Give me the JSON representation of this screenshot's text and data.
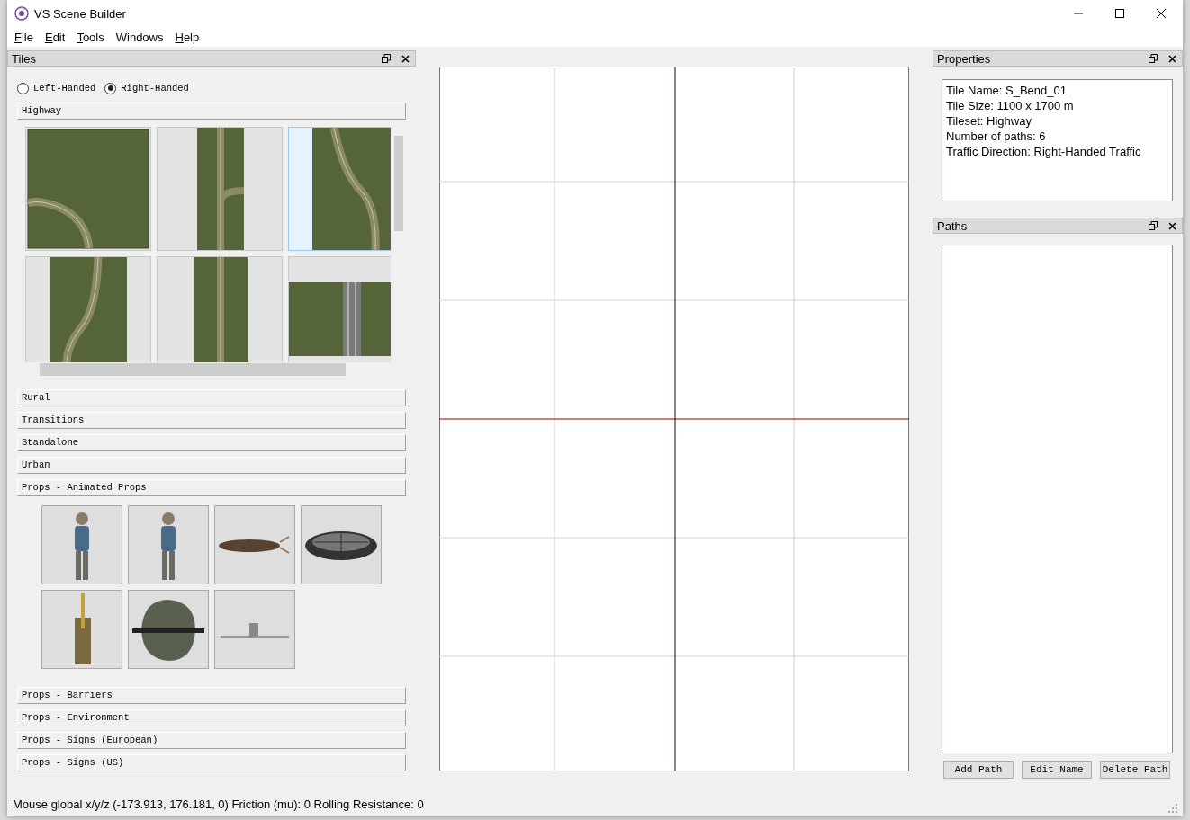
{
  "window": {
    "title": "VS Scene Builder"
  },
  "menu": [
    {
      "label": "File",
      "underline_first": true
    },
    {
      "label": "Edit",
      "underline_first": true
    },
    {
      "label": "Tools",
      "underline_first": true
    },
    {
      "label": "Windows",
      "underline_first": false
    },
    {
      "label": "Help",
      "underline_first": true
    }
  ],
  "tiles_panel": {
    "title": "Tiles",
    "handedness": [
      {
        "label": "Left-Handed",
        "selected": false
      },
      {
        "label": "Right-Handed",
        "selected": true
      }
    ],
    "categories": [
      {
        "label": "Highway",
        "kind": "tiles",
        "tiles": [
          {
            "kind": "corner",
            "selected": false
          },
          {
            "kind": "junction",
            "selected": false
          },
          {
            "kind": "s_bend",
            "selected": true
          },
          {
            "kind": "curve",
            "selected": false
          },
          {
            "kind": "straight",
            "selected": false
          },
          {
            "kind": "bridge",
            "selected": false
          }
        ]
      },
      {
        "label": "Rural"
      },
      {
        "label": "Transitions"
      },
      {
        "label": "Standalone"
      },
      {
        "label": "Urban"
      },
      {
        "label": "Props - Animated Props",
        "kind": "props",
        "props": [
          {
            "kind": "figure"
          },
          {
            "kind": "figure"
          },
          {
            "kind": "log"
          },
          {
            "kind": "fan"
          },
          {
            "kind": "lever"
          },
          {
            "kind": "rock"
          },
          {
            "kind": "plank"
          }
        ]
      },
      {
        "label": "Props - Barriers"
      },
      {
        "label": "Props - Environment"
      },
      {
        "label": "Props - Signs (European)"
      },
      {
        "label": "Props - Signs (US)"
      }
    ]
  },
  "properties_panel": {
    "title": "Properties",
    "lines": [
      "Tile Name: S_Bend_01",
      "Tile Size: 1100 x 1700 m",
      "Tileset: Highway",
      "Number of paths: 6",
      "Traffic Direction: Right-Handed Traffic"
    ]
  },
  "paths_panel": {
    "title": "Paths",
    "buttons": [
      "Add Path",
      "Edit Name",
      "Delete Path"
    ]
  },
  "status_bar": "Mouse global x/y/z (-173.913, 176.181, 0) Friction (mu): 0 Rolling Resistance: 0"
}
